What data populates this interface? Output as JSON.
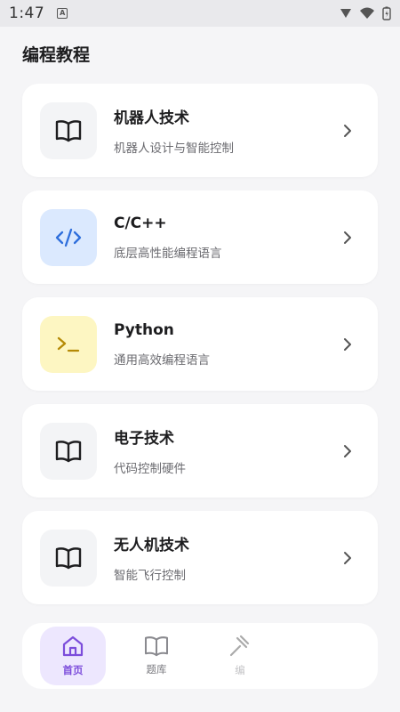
{
  "status": {
    "time": "1:47",
    "notif_letter": "A"
  },
  "page": {
    "title": "编程教程"
  },
  "courses": [
    {
      "title": "机器人技术",
      "subtitle": "机器人设计与智能控制",
      "icon": "book-icon"
    },
    {
      "title": "C/C++",
      "subtitle": "底层高性能编程语言",
      "icon": "code-icon"
    },
    {
      "title": "Python",
      "subtitle": "通用高效编程语言",
      "icon": "terminal-icon"
    },
    {
      "title": "电子技术",
      "subtitle": "代码控制硬件",
      "icon": "book-icon"
    },
    {
      "title": "无人机技术",
      "subtitle": "智能飞行控制",
      "icon": "book-icon"
    }
  ],
  "tabs": [
    {
      "label": "首页",
      "icon": "home-icon",
      "active": true
    },
    {
      "label": "题库",
      "icon": "book-icon",
      "active": false
    },
    {
      "label": "编",
      "icon": "hammer-icon",
      "active": false
    }
  ],
  "colors": {
    "accent": "#7c4ddb",
    "code_icon_bg": "#dbe9fe",
    "code_icon_fg": "#2f6fdc",
    "terminal_icon_bg": "#fdf6c2",
    "terminal_icon_fg": "#b58a06"
  }
}
